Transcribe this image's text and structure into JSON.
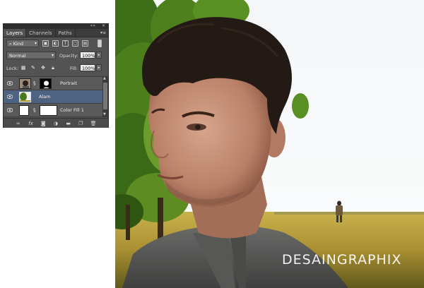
{
  "panel": {
    "tabs": [
      "Layers",
      "Channels",
      "Paths"
    ],
    "active_tab": "Layers",
    "filter": {
      "kind_label": "Kind"
    },
    "blend_mode": "Normal",
    "opacity_label": "Opacity:",
    "opacity_value": "100%",
    "lock_label": "Lock:",
    "fill_label": "Fill:",
    "fill_value": "100%",
    "layers": [
      {
        "name": "Portrait",
        "selected": false,
        "has_mask": true
      },
      {
        "name": "Alam",
        "selected": true,
        "has_mask": false
      },
      {
        "name": "Color Fill 1",
        "selected": false,
        "has_mask": true
      }
    ]
  },
  "canvas": {
    "watermark": "DESAINGRAPHIX"
  },
  "colors": {
    "panel_bg": "#535353",
    "selected_layer": "#4e6382",
    "sky": "#f6f8f9",
    "field": "#b79a3a",
    "tree": "#3f6e18"
  }
}
